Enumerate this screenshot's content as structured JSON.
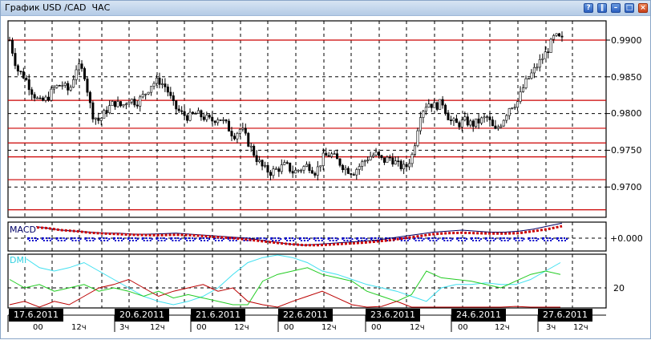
{
  "window": {
    "title": "График USD /CAD  ЧАС",
    "buttons": [
      "help",
      "pause",
      "minimize",
      "maximize",
      "close"
    ]
  },
  "colors": {
    "candle": "#000000",
    "level": "#cc0000",
    "macd_signal": "#cc0000",
    "macd_hist": "#0000cc",
    "macd_line": "#000066",
    "dmi_adx": "#40e0f0",
    "dmi_plus": "#22cc22",
    "dmi_minus": "#bb0000"
  },
  "price_axis": [
    "0.9900",
    "0.9850",
    "0.9800",
    "0.9750",
    "0.9700"
  ],
  "levels": [
    0.99,
    0.9818,
    0.978,
    0.976,
    0.9741,
    0.971,
    0.9669
  ],
  "macd": {
    "label": "MACD",
    "zero_label": "+0.000"
  },
  "dmi": {
    "label": "DMI",
    "level_label": "20"
  },
  "dates": [
    "17.6.2011",
    "20.6.2011",
    "21.6.2011",
    "22.6.2011",
    "23.6.2011",
    "24.6.2011",
    "27.6.2011"
  ],
  "hours": [
    "00",
    "12ч",
    "3ч",
    "12ч",
    "00",
    "12ч",
    "00",
    "12ч",
    "00",
    "12ч",
    "00",
    "12ч",
    "3ч",
    "12ч"
  ],
  "chart_data": {
    "type": "candlestick",
    "title": "График USD /CAD  ЧАС",
    "ylim": [
      0.966,
      0.9925
    ],
    "closes": [
      0.99,
      0.986,
      0.985,
      0.983,
      0.9815,
      0.982,
      0.9835,
      0.984,
      0.983,
      0.9865,
      0.9855,
      0.98,
      0.979,
      0.9805,
      0.9815,
      0.981,
      0.982,
      0.9815,
      0.9825,
      0.984,
      0.9845,
      0.9835,
      0.981,
      0.98,
      0.9795,
      0.98,
      0.9795,
      0.979,
      0.9795,
      0.9785,
      0.977,
      0.978,
      0.976,
      0.974,
      0.9725,
      0.972,
      0.9725,
      0.973,
      0.972,
      0.9725,
      0.973,
      0.972,
      0.974,
      0.9745,
      0.9735,
      0.9725,
      0.972,
      0.973,
      0.974,
      0.9745,
      0.9735,
      0.974,
      0.973,
      0.9725,
      0.9745,
      0.98,
      0.9815,
      0.981,
      0.9815,
      0.979,
      0.9785,
      0.979,
      0.9785,
      0.979,
      0.9795,
      0.9775,
      0.979,
      0.981,
      0.9815,
      0.984,
      0.9855,
      0.987,
      0.9885,
      0.9905,
      0.99
    ],
    "macd": [
      0.6,
      0.5,
      0.4,
      0.35,
      0.3,
      0.25,
      0.25,
      0.2,
      0.2,
      0.22,
      0.25,
      0.2,
      0.15,
      0.1,
      0.05,
      0,
      -0.1,
      -0.2,
      -0.3,
      -0.35,
      -0.3,
      -0.25,
      -0.2,
      -0.15,
      -0.1,
      0,
      0.1,
      0.2,
      0.3,
      0.35,
      0.4,
      0.35,
      0.3,
      0.3,
      0.35,
      0.45,
      0.6,
      0.75
    ],
    "macd_signal": [
      0.6,
      0.55,
      0.45,
      0.4,
      0.32,
      0.28,
      0.25,
      0.22,
      0.2,
      0.2,
      0.22,
      0.2,
      0.15,
      0.1,
      0.05,
      -0.02,
      -0.1,
      -0.18,
      -0.25,
      -0.3,
      -0.3,
      -0.26,
      -0.22,
      -0.18,
      -0.12,
      -0.05,
      0.05,
      0.15,
      0.25,
      0.3,
      0.32,
      0.3,
      0.28,
      0.28,
      0.3,
      0.4,
      0.5,
      0.65
    ],
    "dmi_adx": [
      45,
      38,
      32,
      30,
      32,
      35,
      30,
      25,
      20,
      15,
      12,
      10,
      12,
      15,
      20,
      28,
      35,
      38,
      40,
      38,
      35,
      30,
      28,
      25,
      22,
      20,
      18,
      15,
      12,
      20,
      22,
      22,
      23,
      22,
      22,
      25,
      30,
      35
    ],
    "dmi_plus": [
      25,
      20,
      22,
      18,
      20,
      22,
      18,
      20,
      18,
      15,
      18,
      14,
      16,
      14,
      12,
      10,
      10,
      24,
      28,
      30,
      32,
      28,
      26,
      24,
      18,
      15,
      12,
      16,
      30,
      26,
      25,
      24,
      22,
      20,
      24,
      28,
      30,
      28
    ],
    "dmi_minus": [
      10,
      12,
      8,
      12,
      10,
      15,
      20,
      22,
      25,
      20,
      15,
      18,
      20,
      22,
      18,
      20,
      12,
      10,
      8,
      12,
      15,
      18,
      14,
      10,
      8,
      9,
      12,
      8,
      5,
      6,
      5,
      8,
      6,
      5,
      9,
      6,
      5,
      3
    ]
  }
}
